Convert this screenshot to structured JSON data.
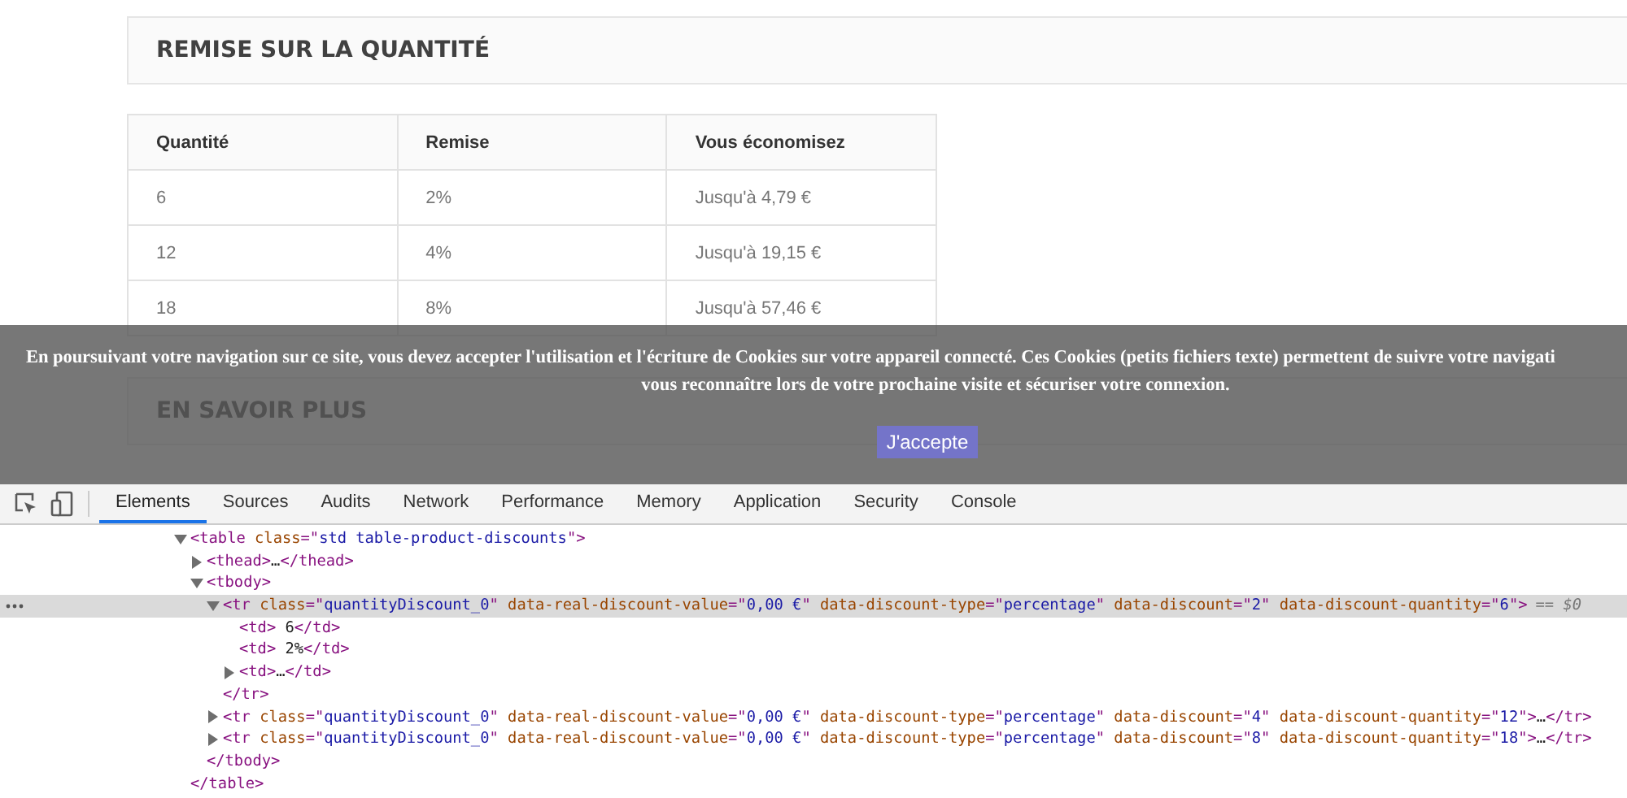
{
  "page": {
    "section_title": "REMISE SUR LA QUANTITÉ",
    "discount_table": {
      "columns": [
        "Quantité",
        "Remise",
        "Vous économisez"
      ],
      "rows": [
        [
          "6",
          "2%",
          "Jusqu'à 4,79 €"
        ],
        [
          "12",
          "4%",
          "Jusqu'à 19,15 €"
        ],
        [
          "18",
          "8%",
          "Jusqu'à 57,46 €"
        ]
      ]
    },
    "next_section_title": "EN SAVOIR PLUS"
  },
  "cookie_banner": {
    "lines": [
      "En poursuivant votre navigation sur ce site, vous devez accepter l'utilisation et l'écriture de Cookies sur votre appareil connecté. Ces Cookies (petits fichiers texte) permettent de suivre votre navigati",
      "vous reconnaître lors de votre prochaine visite et sécuriser votre connexion."
    ],
    "button": "J'accepte"
  },
  "devtools": {
    "tabs": [
      {
        "label": "Elements",
        "selected": true
      },
      {
        "label": "Sources",
        "selected": false
      },
      {
        "label": "Audits",
        "selected": false
      },
      {
        "label": "Network",
        "selected": false
      },
      {
        "label": "Performance",
        "selected": false
      },
      {
        "label": "Memory",
        "selected": false
      },
      {
        "label": "Application",
        "selected": false
      },
      {
        "label": "Security",
        "selected": false
      },
      {
        "label": "Console",
        "selected": false
      }
    ],
    "dom_tree": [
      {
        "open": "<table class=\"std table-product-discounts\">",
        "expanded": true,
        "selected": false,
        "close": "</table>",
        "children": [
          {
            "open": "<thead>",
            "expanded": false,
            "selected": false,
            "content": "…",
            "close": "</thead>"
          },
          {
            "open": "<tbody>",
            "expanded": true,
            "selected": false,
            "close": "</tbody>",
            "children": [
              {
                "open": "<tr class=\"quantityDiscount_0\" data-real-discount-value=\"0,00 €\" data-discount-type=\"percentage\" data-discount=\"2\" data-discount-quantity=\"6\">",
                "expanded": true,
                "selected": true,
                "console_ref": "== $0",
                "close": "</tr>",
                "children": [
                  {
                    "open": "<td>",
                    "content": " 6",
                    "close": "</td>",
                    "selected": false
                  },
                  {
                    "open": "<td>",
                    "content": " 2%",
                    "close": "</td>",
                    "selected": false
                  },
                  {
                    "open": "<td>",
                    "expanded": false,
                    "selected": false,
                    "content": "…",
                    "close": "</td>"
                  }
                ]
              },
              {
                "open": "<tr class=\"quantityDiscount_0\" data-real-discount-value=\"0,00 €\" data-discount-type=\"percentage\" data-discount=\"4\" data-discount-quantity=\"12\">",
                "expanded": false,
                "selected": false,
                "content": "…",
                "close": "</tr>"
              },
              {
                "open": "<tr class=\"quantityDiscount_0\" data-real-discount-value=\"0,00 €\" data-discount-type=\"percentage\" data-discount=\"8\" data-discount-quantity=\"18\">",
                "expanded": false,
                "selected": false,
                "content": "…",
                "close": "</tr>"
              }
            ]
          }
        ]
      }
    ]
  }
}
